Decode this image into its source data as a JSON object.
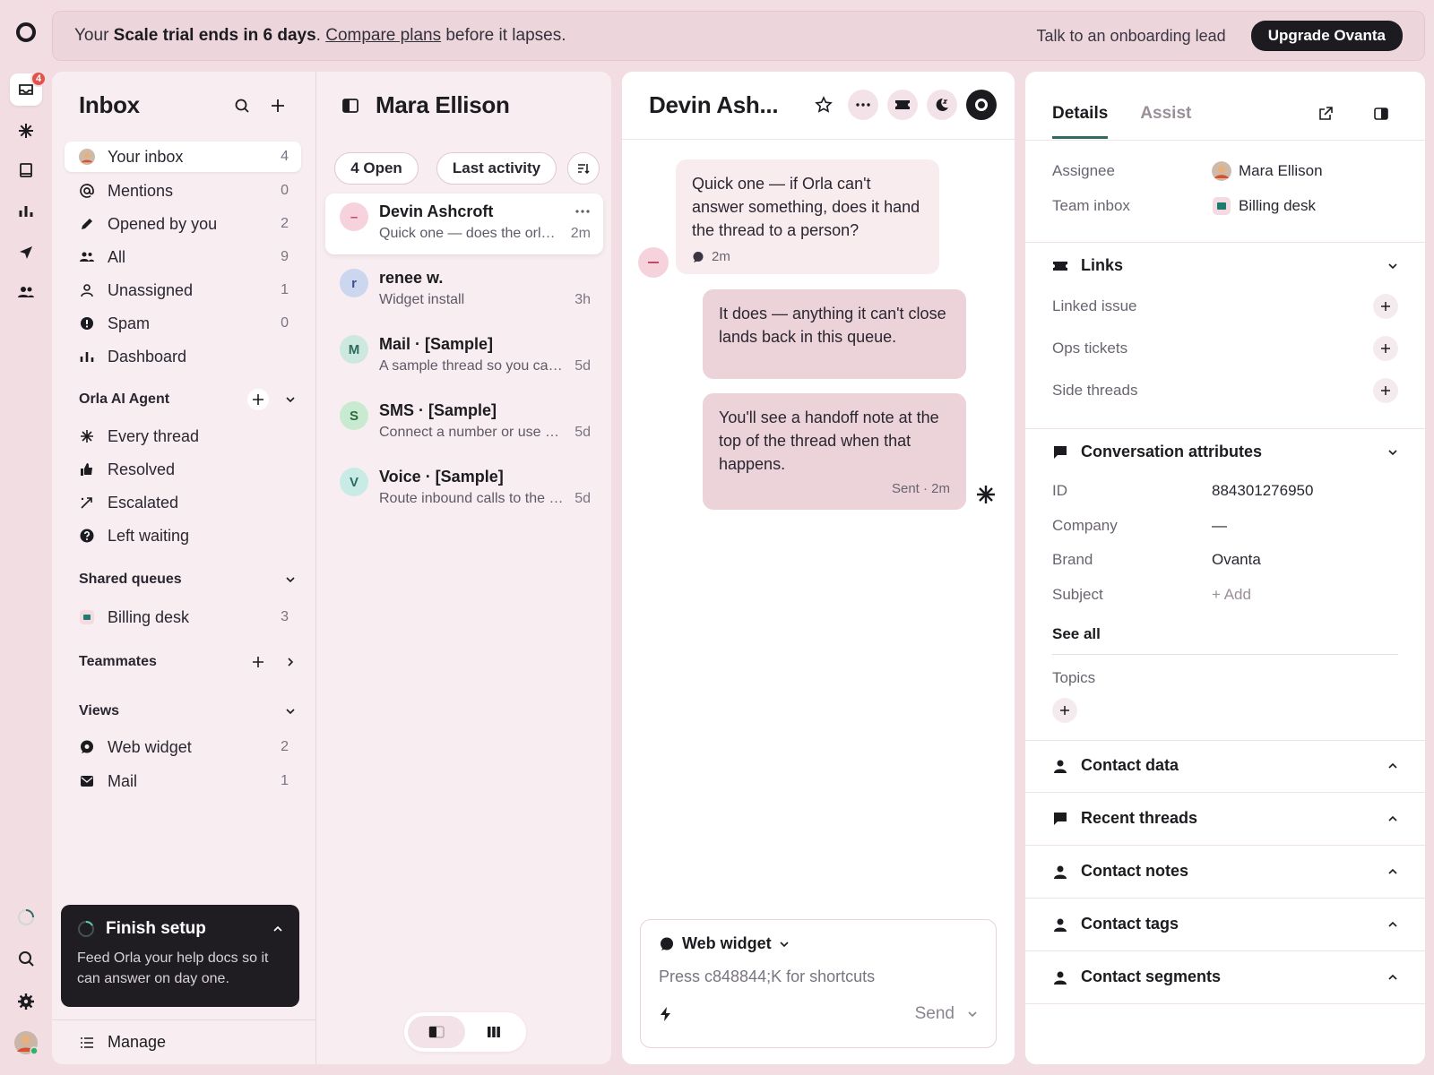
{
  "rail": {
    "inbox_badge": "4"
  },
  "banner": {
    "text_before": "Your ",
    "text_bold": "Scale trial ends in 6 days",
    "text_mid": ". ",
    "link": "Compare plans",
    "text_after": " before it lapses.",
    "onboarding_link": "Talk to an onboarding lead",
    "upgrade_button": "Upgrade Ovanta"
  },
  "nav": {
    "title": "Inbox",
    "items": [
      {
        "label": "Your inbox",
        "count": "4"
      },
      {
        "label": "Mentions",
        "count": "0"
      },
      {
        "label": "Opened by you",
        "count": "2"
      },
      {
        "label": "All",
        "count": "9"
      },
      {
        "label": "Unassigned",
        "count": "1"
      },
      {
        "label": "Spam",
        "count": "0"
      },
      {
        "label": "Dashboard",
        "count": ""
      }
    ],
    "ai_section": "Orla AI Agent",
    "ai_items": [
      {
        "label": "Every thread"
      },
      {
        "label": "Resolved"
      },
      {
        "label": "Escalated"
      },
      {
        "label": "Left waiting"
      }
    ],
    "shared_section": "Shared queues",
    "shared_items": [
      {
        "label": "Billing desk",
        "count": "3"
      }
    ],
    "teammates_section": "Teammates",
    "views_section": "Views",
    "view_items": [
      {
        "label": "Web widget",
        "count": "2"
      },
      {
        "label": "Mail",
        "count": "1"
      }
    ],
    "setup_title": "Finish setup",
    "setup_text": "Feed Orla your help docs so it can answer on day one.",
    "manage": "Manage"
  },
  "list": {
    "title": "Mara Ellison",
    "open_filter": "4 Open",
    "sort_filter": "Last activity",
    "threads": [
      {
        "initial": "–",
        "name": "Devin Ashcroft",
        "preview": "Quick one — does the orla hand off",
        "time": "2m"
      },
      {
        "initial": "r",
        "name": "renee w.",
        "preview": "Widget install",
        "time": "3h"
      },
      {
        "initial": "M",
        "name": "Mail · [Sample]",
        "preview": "A sample thread so you can see mail",
        "time": "5d"
      },
      {
        "initial": "S",
        "name": "SMS · [Sample]",
        "preview": "Connect a number or use ours",
        "time": "5d"
      },
      {
        "initial": "V",
        "name": "Voice · [Sample]",
        "preview": "Route inbound calls to the team",
        "time": "5d"
      }
    ]
  },
  "convo": {
    "title": "Devin Ash...",
    "messages": [
      {
        "text": "Quick one — if Orla can't answer something, does it hand the thread to a person?",
        "meta": "2m"
      },
      {
        "text": "It does — anything it can't close lands back in this queue.",
        "meta": ""
      },
      {
        "text": "You'll see a handoff note at the top of the thread when that happens.",
        "meta": "Sent · 2m"
      }
    ],
    "composer_channel": "Web widget",
    "composer_placeholder": "Press c848844;K for shortcuts",
    "send": "Send"
  },
  "details": {
    "tabs": [
      "Details",
      "Assist"
    ],
    "assignee_label": "Assignee",
    "assignee_value": "Mara Ellison",
    "team_label": "Team inbox",
    "team_value": "Billing desk",
    "links_section": "Links",
    "links": [
      "Linked issue",
      "Ops tickets",
      "Side threads"
    ],
    "attrs_section": "Conversation attributes",
    "attrs": [
      {
        "key": "ID",
        "value": "884301276950"
      },
      {
        "key": "Company",
        "value": "—"
      },
      {
        "key": "Brand",
        "value": "Ovanta"
      },
      {
        "key": "Subject",
        "value": "+ Add"
      }
    ],
    "see_all": "See all",
    "topics": "Topics",
    "collapsed_sections": [
      "Contact data",
      "Recent threads",
      "Contact notes",
      "Contact tags",
      "Contact segments"
    ]
  },
  "colors": {
    "accent": "#2f6b63",
    "banner_bg": "#ecd6dc",
    "dark": "#1c1b1f"
  }
}
